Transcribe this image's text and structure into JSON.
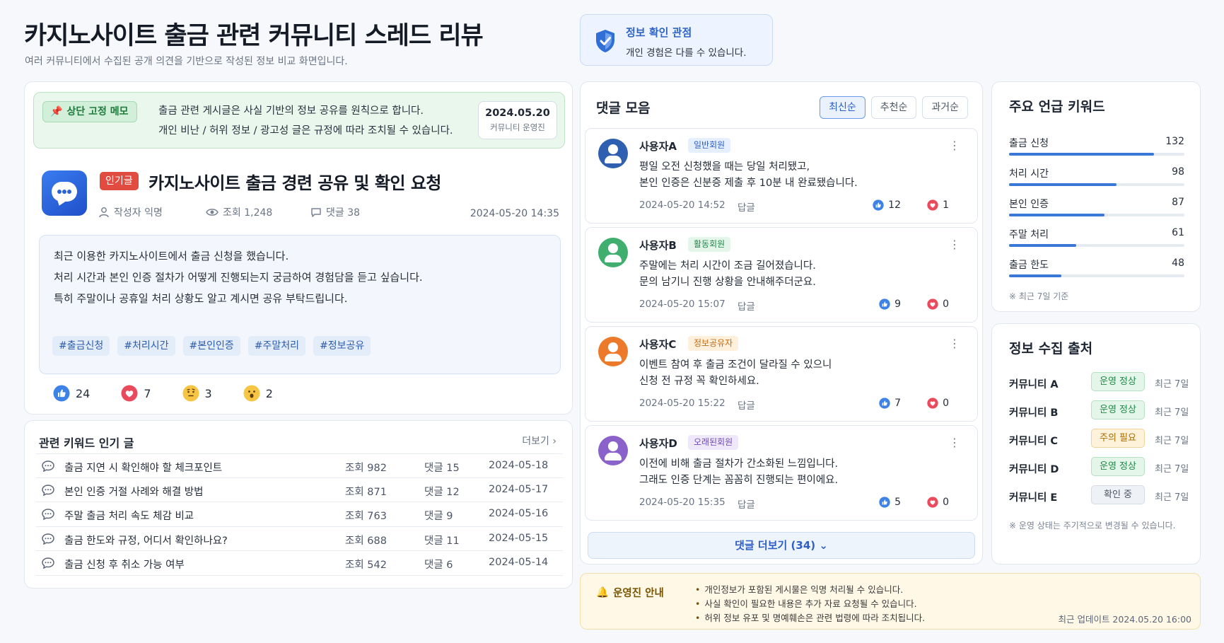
{
  "header": {
    "title": "카지노사이트 출금 관련 커뮤니티 스레드 리뷰",
    "subtitle": "여러 커뮤니티에서 수집된 공개 의견을 기반으로 작성된 정보 비교 화면입니다."
  },
  "info_box": {
    "title": "정보 확인 관점",
    "text": "개인 경험은 다를 수 있습니다."
  },
  "pinned": {
    "badge": "상단 고정 메모",
    "line1": "출금 관련 게시글은 사실 기반의 정보 공유를 원칙으로 합니다.",
    "line2": "개인 비난 / 허위 정보 / 광고성 글은 규정에 따라 조치될 수 있습니다.",
    "date": "2024.05.20",
    "author": "커뮤니티 운영진"
  },
  "post": {
    "badge": "인기글",
    "title": "카지노사이트 출금 경련 공유 및 확인 요청",
    "author": "작성자 익명",
    "views": "조회 1,248",
    "comments": "댓글 38",
    "date": "2024-05-20 14:35",
    "body": [
      "최근 이용한 카지노사이트에서 출금 신청을 했습니다.",
      "처리 시간과 본인 인증 절차가 어떻게 진행되는지 궁금하여 경험담을 듣고 싶습니다.",
      "특히 주말이나 공휴일 처리 상황도 알고 계시면 공유 부탁드립니다."
    ],
    "tags": [
      "#출금신청",
      "#처리시간",
      "#본인인증",
      "#주말처리",
      "#정보공유"
    ],
    "reactions": {
      "like": "24",
      "heart": "7",
      "think": "3",
      "wow": "2"
    }
  },
  "related": {
    "title": "관련 키워드 인기 글",
    "more": "더보기 ›",
    "rows": [
      {
        "title": "출금 지연 시 확인해야 할 체크포인트",
        "views": "조회 982",
        "comments": "댓글 15",
        "date": "2024-05-18"
      },
      {
        "title": "본인 인증 거절 사례와 해결 방법",
        "views": "조회 871",
        "comments": "댓글 12",
        "date": "2024-05-17"
      },
      {
        "title": "주말 출금 처리 속도 체감 비교",
        "views": "조회 763",
        "comments": "댓글 9",
        "date": "2024-05-16"
      },
      {
        "title": "출금 한도와 규정, 어디서 확인하나요?",
        "views": "조회 688",
        "comments": "댓글 11",
        "date": "2024-05-15"
      },
      {
        "title": "출금 신청 후 취소 가능 여부",
        "views": "조회 542",
        "comments": "댓글 6",
        "date": "2024-05-14"
      }
    ]
  },
  "comments": {
    "title": "댓글 모음",
    "sort": [
      "최신순",
      "추천순",
      "과거순"
    ],
    "reply_label": "답글",
    "items": [
      {
        "name": "사용자A",
        "role": "일반회원",
        "line1": "평일 오전 신청했을 때는 당일 처리됐고,",
        "line2": "본인 인증은 신분증 제출 후 10분 내 완료됐습니다.",
        "date": "2024-05-20 14:52",
        "likes": "12",
        "hearts": "1",
        "avatar_color": "#2f5fb0",
        "role_bg": "#e6efff",
        "role_fg": "#2d5fc4"
      },
      {
        "name": "사용자B",
        "role": "활동회원",
        "line1": "주말에는 처리 시간이 조금 길어졌습니다.",
        "line2": "문의 남기니 진행 상황을 안내해주더군요.",
        "date": "2024-05-20 15:07",
        "likes": "9",
        "hearts": "0",
        "avatar_color": "#3fae6e",
        "role_bg": "#e4f5ea",
        "role_fg": "#23884a"
      },
      {
        "name": "사용자C",
        "role": "정보공유자",
        "line1": "이벤트 참여 후 출금 조건이 달라질 수 있으니",
        "line2": "신청 전 규정 꼭 확인하세요.",
        "date": "2024-05-20 15:22",
        "likes": "7",
        "hearts": "0",
        "avatar_color": "#ec7a2a",
        "role_bg": "#fff0dc",
        "role_fg": "#c46a10"
      },
      {
        "name": "사용자D",
        "role": "오래된회원",
        "line1": "이전에 비해 출금 절차가 간소화된 느낌입니다.",
        "line2": "그래도 인증 단계는 꼼꼼히 진행되는 편이에요.",
        "date": "2024-05-20 15:35",
        "likes": "5",
        "hearts": "0",
        "avatar_color": "#8a62c9",
        "role_bg": "#efe8fb",
        "role_fg": "#7048b8"
      }
    ],
    "more": "댓글 더보기 (34) ⌄"
  },
  "keywords": {
    "title": "주요 언급 키워드",
    "items": [
      {
        "label": "출금 신청",
        "value": 132
      },
      {
        "label": "처리 시간",
        "value": 98
      },
      {
        "label": "본인 인증",
        "value": 87
      },
      {
        "label": "주말 처리",
        "value": 61
      },
      {
        "label": "출금 한도",
        "value": 48
      }
    ],
    "max": 160,
    "note": "※ 최근 7일 기준"
  },
  "sources": {
    "title": "정보 수집 출처",
    "items": [
      {
        "name": "커뮤니티 A",
        "status": "운영 정상",
        "period": "최근 7일",
        "kind": "ok"
      },
      {
        "name": "커뮤니티 B",
        "status": "운영 정상",
        "period": "최근 7일",
        "kind": "ok"
      },
      {
        "name": "커뮤니티 C",
        "status": "주의 필요",
        "period": "최근 7일",
        "kind": "warn"
      },
      {
        "name": "커뮤니티 D",
        "status": "운영 정상",
        "period": "최근 7일",
        "kind": "ok"
      },
      {
        "name": "커뮤니티 E",
        "status": "확인 중",
        "period": "최근 7일",
        "kind": "pending"
      }
    ],
    "note": "※ 운영 상태는 주기적으로 변경될 수 있습니다."
  },
  "notice": {
    "title": "운영진 안내",
    "items": [
      "개인정보가 포함된 게시물은 익명 처리될 수 있습니다.",
      "사실 확인이 필요한 내용은 추가 자료 요청될 수 있습니다.",
      "허위 정보 유포 및 명예훼손은 관련 법령에 따라 조치됩니다."
    ],
    "updated": "최근 업데이트 2024.05.20 16:00"
  }
}
